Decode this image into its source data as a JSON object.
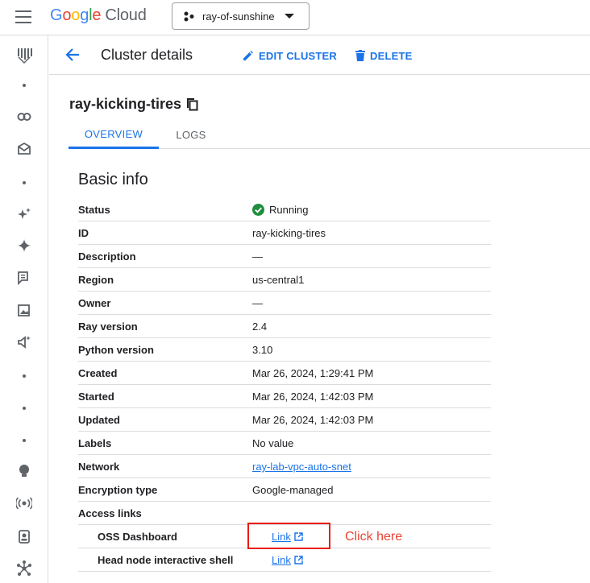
{
  "app": {
    "logo_google": [
      "G",
      "o",
      "o",
      "g",
      "l",
      "e"
    ],
    "logo_cloud": "Cloud",
    "project": "ray-of-sunshine"
  },
  "header": {
    "title": "Cluster details",
    "edit_label": "EDIT CLUSTER",
    "delete_label": "DELETE"
  },
  "resource": {
    "name": "ray-kicking-tires"
  },
  "tabs": [
    {
      "label": "OVERVIEW",
      "active": true
    },
    {
      "label": "LOGS",
      "active": false
    }
  ],
  "basic_info": {
    "title": "Basic info",
    "rows": [
      {
        "key": "Status",
        "value": "Running"
      },
      {
        "key": "ID",
        "value": "ray-kicking-tires"
      },
      {
        "key": "Description",
        "value": "—"
      },
      {
        "key": "Region",
        "value": "us-central1"
      },
      {
        "key": "Owner",
        "value": "—"
      },
      {
        "key": "Ray version",
        "value": "2.4"
      },
      {
        "key": "Python version",
        "value": "3.10"
      },
      {
        "key": "Created",
        "value": "Mar 26, 2024, 1:29:41 PM"
      },
      {
        "key": "Started",
        "value": "Mar 26, 2024, 1:42:03 PM"
      },
      {
        "key": "Updated",
        "value": "Mar 26, 2024, 1:42:03 PM"
      },
      {
        "key": "Labels",
        "value": "No value"
      },
      {
        "key": "Network",
        "value": "ray-lab-vpc-auto-snet"
      },
      {
        "key": "Encryption type",
        "value": "Google-managed"
      },
      {
        "key": "Access links",
        "value": ""
      },
      {
        "key": "OSS Dashboard",
        "value": "Link"
      },
      {
        "key": "Head node interactive shell",
        "value": "Link"
      }
    ]
  },
  "annotation": {
    "callout": "Click here"
  },
  "colors": {
    "accent": "#1a73e8",
    "success": "#1e8e3e",
    "annotation": "#ea4335"
  }
}
